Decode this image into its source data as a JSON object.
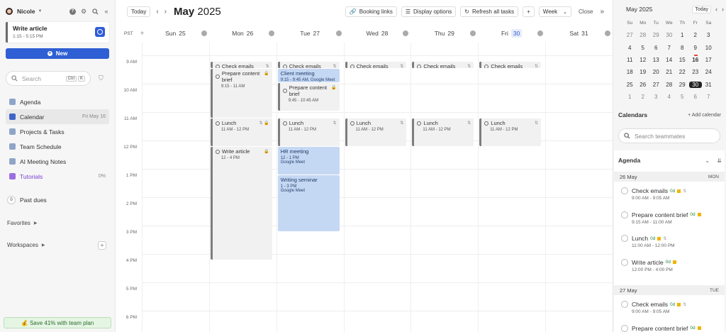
{
  "sidebar": {
    "user_name": "Nicole",
    "current_task": {
      "title": "Write article",
      "time": "1:15 - 5:15 PM"
    },
    "new_label": "New",
    "search": {
      "placeholder": "Search",
      "kbd1": "Ctrl",
      "kbd2": "K"
    },
    "nav": [
      {
        "label": "Agenda",
        "right": ""
      },
      {
        "label": "Calendar",
        "right": "Fri May 16"
      },
      {
        "label": "Projects & Tasks",
        "right": ""
      },
      {
        "label": "Team Schedule",
        "right": ""
      },
      {
        "label": "AI Meeting Notes",
        "right": ""
      },
      {
        "label": "Tutorials",
        "right": "0%"
      }
    ],
    "past_dues": {
      "count": "0",
      "label": "Past dues"
    },
    "favorites": "Favorites",
    "workspaces": "Workspaces",
    "promo": "💰 Save 41% with team plan"
  },
  "header": {
    "today": "Today",
    "month": "May",
    "year": "2025",
    "booking_links": "Booking links",
    "display_options": "Display options",
    "refresh": "Refresh all tasks",
    "plus": "+",
    "view": "Week",
    "close": "Close"
  },
  "days": {
    "tz": "PST",
    "list": [
      {
        "dow": "Sun",
        "num": "25"
      },
      {
        "dow": "Mon",
        "num": "26"
      },
      {
        "dow": "Tue",
        "num": "27"
      },
      {
        "dow": "Wed",
        "num": "28"
      },
      {
        "dow": "Thu",
        "num": "29"
      },
      {
        "dow": "Fri",
        "num": "30"
      },
      {
        "dow": "Sat",
        "num": "31"
      }
    ]
  },
  "hours": [
    "9 AM",
    "10 AM",
    "11 AM",
    "12 PM",
    "1 PM",
    "2 PM",
    "3 PM",
    "4 PM",
    "5 PM",
    "6 PM"
  ],
  "events": [
    {
      "day": 1,
      "start": 9.0,
      "end": 9.25,
      "title": "Check emails",
      "sub": "",
      "style": "gray",
      "icon": "⇅"
    },
    {
      "day": 1,
      "start": 9.25,
      "end": 11.0,
      "title": "Prepare content brief",
      "sub": "9:15 - 11 AM",
      "style": "gray",
      "icon": "🔒"
    },
    {
      "day": 1,
      "start": 11.0,
      "end": 12.0,
      "title": "Lunch",
      "sub": "11 AM - 12 PM",
      "style": "gray",
      "icon": "⇅ 🔒"
    },
    {
      "day": 1,
      "start": 12.0,
      "end": 16.0,
      "title": "Write article",
      "sub": "12 - 4 PM",
      "style": "gray",
      "icon": "🔒"
    },
    {
      "day": 2,
      "start": 9.0,
      "end": 9.25,
      "title": "Check emails",
      "sub": "",
      "style": "gray",
      "icon": "⇅"
    },
    {
      "day": 2,
      "start": 9.25,
      "end": 9.75,
      "title": "Client meeting",
      "sub": "9:15 - 9:45 AM, Google Meet",
      "style": "blue",
      "icon": ""
    },
    {
      "day": 2,
      "start": 9.75,
      "end": 10.75,
      "title": "Prepare content brief",
      "sub": "9:45 - 10:45 AM",
      "style": "gray",
      "icon": "🔒"
    },
    {
      "day": 2,
      "start": 11.0,
      "end": 12.0,
      "title": "Lunch",
      "sub": "11 AM - 12 PM",
      "style": "gray",
      "icon": "⇅"
    },
    {
      "day": 2,
      "start": 12.0,
      "end": 13.0,
      "title": "HR meeting",
      "sub": "12 - 1 PM\nGoogle Meet",
      "style": "blue",
      "icon": ""
    },
    {
      "day": 2,
      "start": 13.0,
      "end": 15.0,
      "title": "Writing seminar",
      "sub": "1 - 3 PM\nGoogle Meet",
      "style": "blue",
      "icon": ""
    },
    {
      "day": 3,
      "start": 9.0,
      "end": 9.25,
      "title": "Check emails",
      "sub": "",
      "style": "gray",
      "icon": "⇅"
    },
    {
      "day": 3,
      "start": 11.0,
      "end": 12.0,
      "title": "Lunch",
      "sub": "11 AM - 12 PM",
      "style": "gray",
      "icon": "⇅"
    },
    {
      "day": 4,
      "start": 9.0,
      "end": 9.25,
      "title": "Check emails",
      "sub": "",
      "style": "gray",
      "icon": "⇅"
    },
    {
      "day": 4,
      "start": 11.0,
      "end": 12.0,
      "title": "Lunch",
      "sub": "11 AM - 12 PM",
      "style": "gray",
      "icon": "⇅"
    },
    {
      "day": 5,
      "start": 9.0,
      "end": 9.25,
      "title": "Check emails",
      "sub": "",
      "style": "gray",
      "icon": "⇅"
    },
    {
      "day": 5,
      "start": 11.0,
      "end": 12.0,
      "title": "Lunch",
      "sub": "11 AM - 12 PM",
      "style": "gray",
      "icon": "⇅"
    }
  ],
  "mini_calendar": {
    "title": "May 2025",
    "today_btn": "Today",
    "dow": [
      "Su",
      "Mo",
      "Tu",
      "We",
      "Th",
      "Fr",
      "Sa"
    ],
    "weeks": [
      [
        "27",
        "28",
        "29",
        "30",
        "1",
        "2",
        "3"
      ],
      [
        "4",
        "5",
        "6",
        "7",
        "8",
        "9",
        "10"
      ],
      [
        "11",
        "12",
        "13",
        "14",
        "15",
        "16",
        "17"
      ],
      [
        "18",
        "19",
        "20",
        "21",
        "22",
        "23",
        "24"
      ],
      [
        "25",
        "26",
        "27",
        "28",
        "29",
        "30",
        "31"
      ],
      [
        "1",
        "2",
        "3",
        "4",
        "5",
        "6",
        "7"
      ]
    ],
    "today": "16",
    "selected": "30"
  },
  "calendars": {
    "title": "Calendars",
    "add": "+ Add calendar",
    "search_placeholder": "Search teammates"
  },
  "agenda": {
    "title": "Agenda",
    "days": [
      {
        "label": "26 May",
        "dow": "MON",
        "items": [
          {
            "title": "Check emails",
            "od": "0d",
            "time": "9:00 AM - 9:05 AM",
            "rep": true
          },
          {
            "title": "Prepare content brief",
            "od": "0d",
            "time": "9:15 AM - 11:00 AM",
            "rep": false
          },
          {
            "title": "Lunch",
            "od": "0d",
            "time": "11:00 AM - 12:00 PM",
            "rep": true
          },
          {
            "title": "Write article",
            "od": "0d",
            "time": "12:00 PM - 4:00 PM",
            "rep": false
          }
        ]
      },
      {
        "label": "27 May",
        "dow": "TUE",
        "items": [
          {
            "title": "Check emails",
            "od": "0d",
            "time": "9:00 AM - 9:05 AM",
            "rep": true
          },
          {
            "title": "Prepare content brief",
            "od": "0d",
            "time": "",
            "rep": false
          }
        ]
      }
    ]
  },
  "colors": {
    "accent": "#2f5fd4",
    "event_blue": "#c5d8f3",
    "event_gray": "#f1f1f1",
    "today_marker": "#e04a3a"
  }
}
